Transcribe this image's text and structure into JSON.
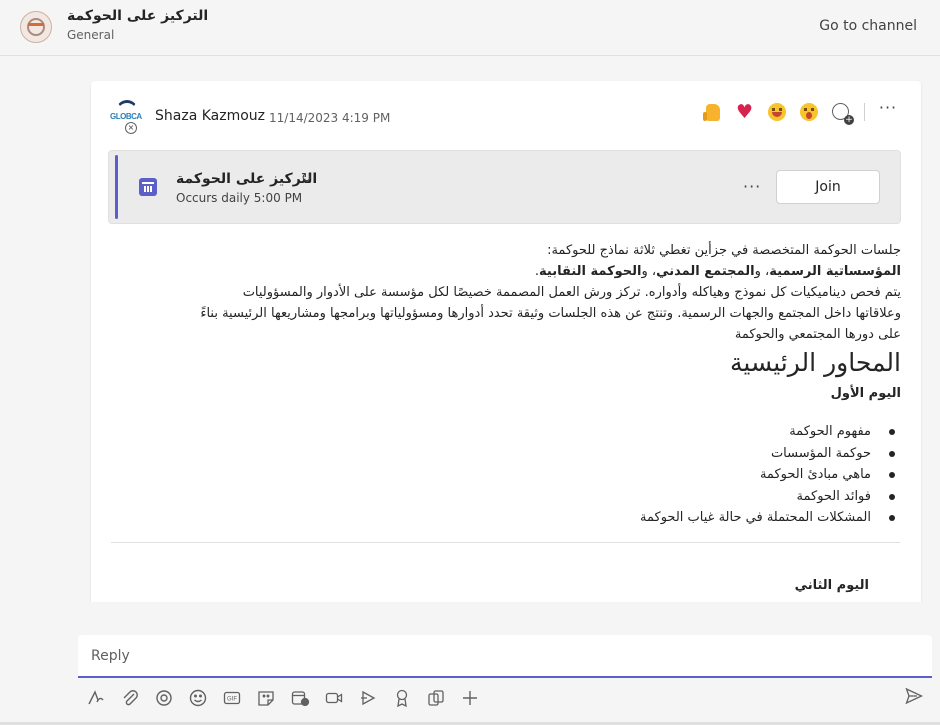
{
  "header": {
    "channel_title": "التركيز على الحوكمة",
    "channel_subtitle": "General",
    "go_to_channel": "Go to channel"
  },
  "post": {
    "logo_text": "GLOBCA",
    "author": "Shaza Kazmouz",
    "timestamp": "11/14/2023 4:19 PM",
    "reactions": [
      "like-emoji",
      "heart-emoji",
      "laugh-emoji",
      "surprised-emoji",
      "add-reaction-icon"
    ],
    "more": "···",
    "meeting": {
      "title": "التركيز على الحوكمة",
      "schedule": "Occurs daily 5:00 PM",
      "more": "···",
      "join_label": "Join"
    },
    "paragraph": {
      "line1": "جلسات الحوكمة المتخصصة في جزأين تغطي ثلاثة نماذج للحوكمة:",
      "line2_a": "المؤسساتية الرسمية",
      "line2_b": "، و",
      "line2_c": "المجتمع المدني",
      "line2_d": "، و",
      "line2_e": "الحوكمة النقابية",
      "line2_f": ".",
      "line3": "يتم فحص ديناميكيات كل نموذج وهياكله وأدواره. تركز ورش العمل المصممة خصيصًا لكل مؤسسة على الأدوار والمسؤوليات",
      "line4": "وعلاقاتها داخل المجتمع والجهات الرسمية. وتنتج عن هذه الجلسات وثيقة تحدد أدوارها ومسؤولياتها وبرامجها ومشاريعها الرئيسية بناءً",
      "line5": "على دورها المجتمعي والحوكمة"
    },
    "heading": "المحاور الرئيسية",
    "day1_label": "اليوم الأول",
    "day1_items": [
      "مفهوم الحوكمة",
      "حوكمة المؤسسات",
      "ماهي مبادئ الحوكمة",
      "فوائد الحوكمة",
      "المشكلات المحتملة في حالة غياب الحوكمة"
    ],
    "day2_label": "اليوم الثاني"
  },
  "reply": {
    "placeholder": "Reply"
  },
  "toolbar": {
    "tools": [
      "format-icon",
      "attach-icon",
      "loop-icon",
      "emoji-icon",
      "gif-icon",
      "sticker-icon",
      "schedule-meeting-icon",
      "video-clip-icon",
      "stream-icon",
      "praise-icon",
      "apps-icon",
      "add-icon"
    ],
    "gif_text": "GIF",
    "send": "send-icon"
  },
  "colors": {
    "accent": "#5b5fc7",
    "background": "#f5f5f5",
    "card": "#ffffff"
  }
}
